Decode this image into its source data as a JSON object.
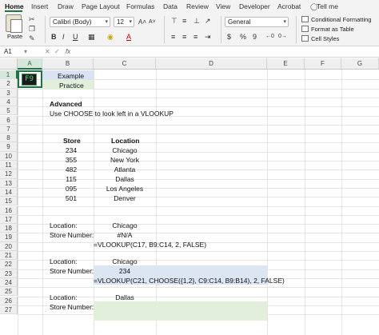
{
  "ribbon": {
    "tabs": [
      "Home",
      "Insert",
      "Draw",
      "Page Layout",
      "Formulas",
      "Data",
      "Review",
      "View",
      "Developer",
      "Acrobat"
    ],
    "tell_me": "Tell me",
    "paste_label": "Paste",
    "font_name": "Calibri (Body)",
    "font_size": "12",
    "number_format": "General",
    "conditional_formatting": "Conditional Formatting",
    "format_as_table": "Format as Table",
    "cell_styles": "Cell Styles",
    "bold": "B",
    "italic": "I",
    "underline": "U",
    "grow_font": "A˄",
    "shrink_font": "A˅",
    "font_color": "A",
    "currency": "$",
    "percent": "%",
    "comma": "9"
  },
  "formula_bar": {
    "name_box": "A1",
    "cancel": "✕",
    "enter": "✓",
    "fx": "fx",
    "content": ""
  },
  "columns": [
    "A",
    "B",
    "C",
    "D",
    "E",
    "F",
    "G"
  ],
  "rows": [
    "1",
    "2",
    "3",
    "4",
    "5",
    "6",
    "7",
    "8",
    "9",
    "10",
    "11",
    "12",
    "13",
    "14",
    "15",
    "16",
    "17",
    "18",
    "19",
    "20",
    "21",
    "22",
    "23",
    "24",
    "25",
    "26",
    "27"
  ],
  "sheet": {
    "f9_label": "F9",
    "example": "Example",
    "practice": "Practice",
    "advanced": "Advanced",
    "subtitle": "Use CHOOSE to look left in a VLOOKUP",
    "table_headers": {
      "store": "Store",
      "location": "Location"
    },
    "table_rows": [
      {
        "store": "234",
        "location": "Chicago"
      },
      {
        "store": "355",
        "location": "New York"
      },
      {
        "store": "482",
        "location": "Atlanta"
      },
      {
        "store": "115",
        "location": "Dallas"
      },
      {
        "store": "095",
        "location": "Los Angeles"
      },
      {
        "store": "501",
        "location": "Denver"
      }
    ],
    "block1": {
      "location_label": "Location:",
      "location_value": "Chicago",
      "store_label": "Store Number:",
      "store_value": "#N/A",
      "formula": "=VLOOKUP(C17, B9:C14, 2, FALSE)"
    },
    "block2": {
      "location_label": "Location:",
      "location_value": "Chicago",
      "store_label": "Store Number:",
      "store_value": "234",
      "formula": "=VLOOKUP(C21, CHOOSE({1,2}, C9:C14, B9:B14), 2, FALSE)"
    },
    "block3": {
      "location_label": "Location:",
      "location_value": "Dallas",
      "store_label": "Store Number:"
    }
  },
  "colors": {
    "excel_green": "#217346",
    "example_fill": "#dae3f3",
    "practice_fill": "#e2efda",
    "formula_fill": "#dce6f2",
    "practice_input_fill": "#e2efda"
  }
}
